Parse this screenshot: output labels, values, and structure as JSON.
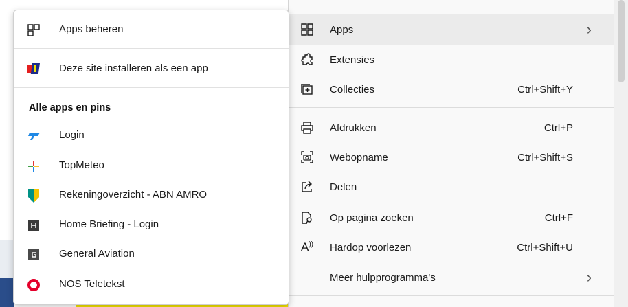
{
  "main_menu": {
    "items": [
      {
        "label": "Apps",
        "shortcut": "",
        "submenu": true,
        "icon": "apps-icon"
      },
      {
        "label": "Extensies",
        "shortcut": "",
        "submenu": false,
        "icon": "puzzle-icon"
      },
      {
        "label": "Collecties",
        "shortcut": "Ctrl+Shift+Y",
        "submenu": false,
        "icon": "collections-icon"
      },
      {
        "label": "Afdrukken",
        "shortcut": "Ctrl+P",
        "submenu": false,
        "icon": "printer-icon"
      },
      {
        "label": "Webopname",
        "shortcut": "Ctrl+Shift+S",
        "submenu": false,
        "icon": "web-capture-icon"
      },
      {
        "label": "Delen",
        "shortcut": "",
        "submenu": false,
        "icon": "share-icon"
      },
      {
        "label": "Op pagina zoeken",
        "shortcut": "Ctrl+F",
        "submenu": false,
        "icon": "find-on-page-icon"
      },
      {
        "label": "Hardop voorlezen",
        "shortcut": "Ctrl+Shift+U",
        "submenu": false,
        "icon": "read-aloud-icon"
      },
      {
        "label": "Meer hulpprogramma's",
        "shortcut": "",
        "submenu": true,
        "icon": ""
      }
    ]
  },
  "apps_submenu": {
    "manage_label": "Apps beheren",
    "install_label": "Deze site installeren als een app",
    "heading": "Alle apps en pins",
    "apps": [
      {
        "label": "Login",
        "icon": "login-app-icon",
        "color": "#1e88e5"
      },
      {
        "label": "TopMeteo",
        "icon": "topmeteo-icon",
        "color": "#e53935"
      },
      {
        "label": "Rekeningoverzicht - ABN AMRO",
        "icon": "abn-amro-icon",
        "color": "#009286"
      },
      {
        "label": "Home Briefing - Login",
        "icon": "home-briefing-icon",
        "color": "#3a3a3a"
      },
      {
        "label": "General Aviation",
        "icon": "general-aviation-icon",
        "color": "#4a4a4a"
      },
      {
        "label": "NOS Teletekst",
        "icon": "nos-teletekst-icon",
        "color": "#e4002b"
      }
    ]
  },
  "colors": {
    "highlight": "#ebebeb",
    "menu_bg": "#f9f9f9",
    "submenu_bg": "#ffffff"
  }
}
